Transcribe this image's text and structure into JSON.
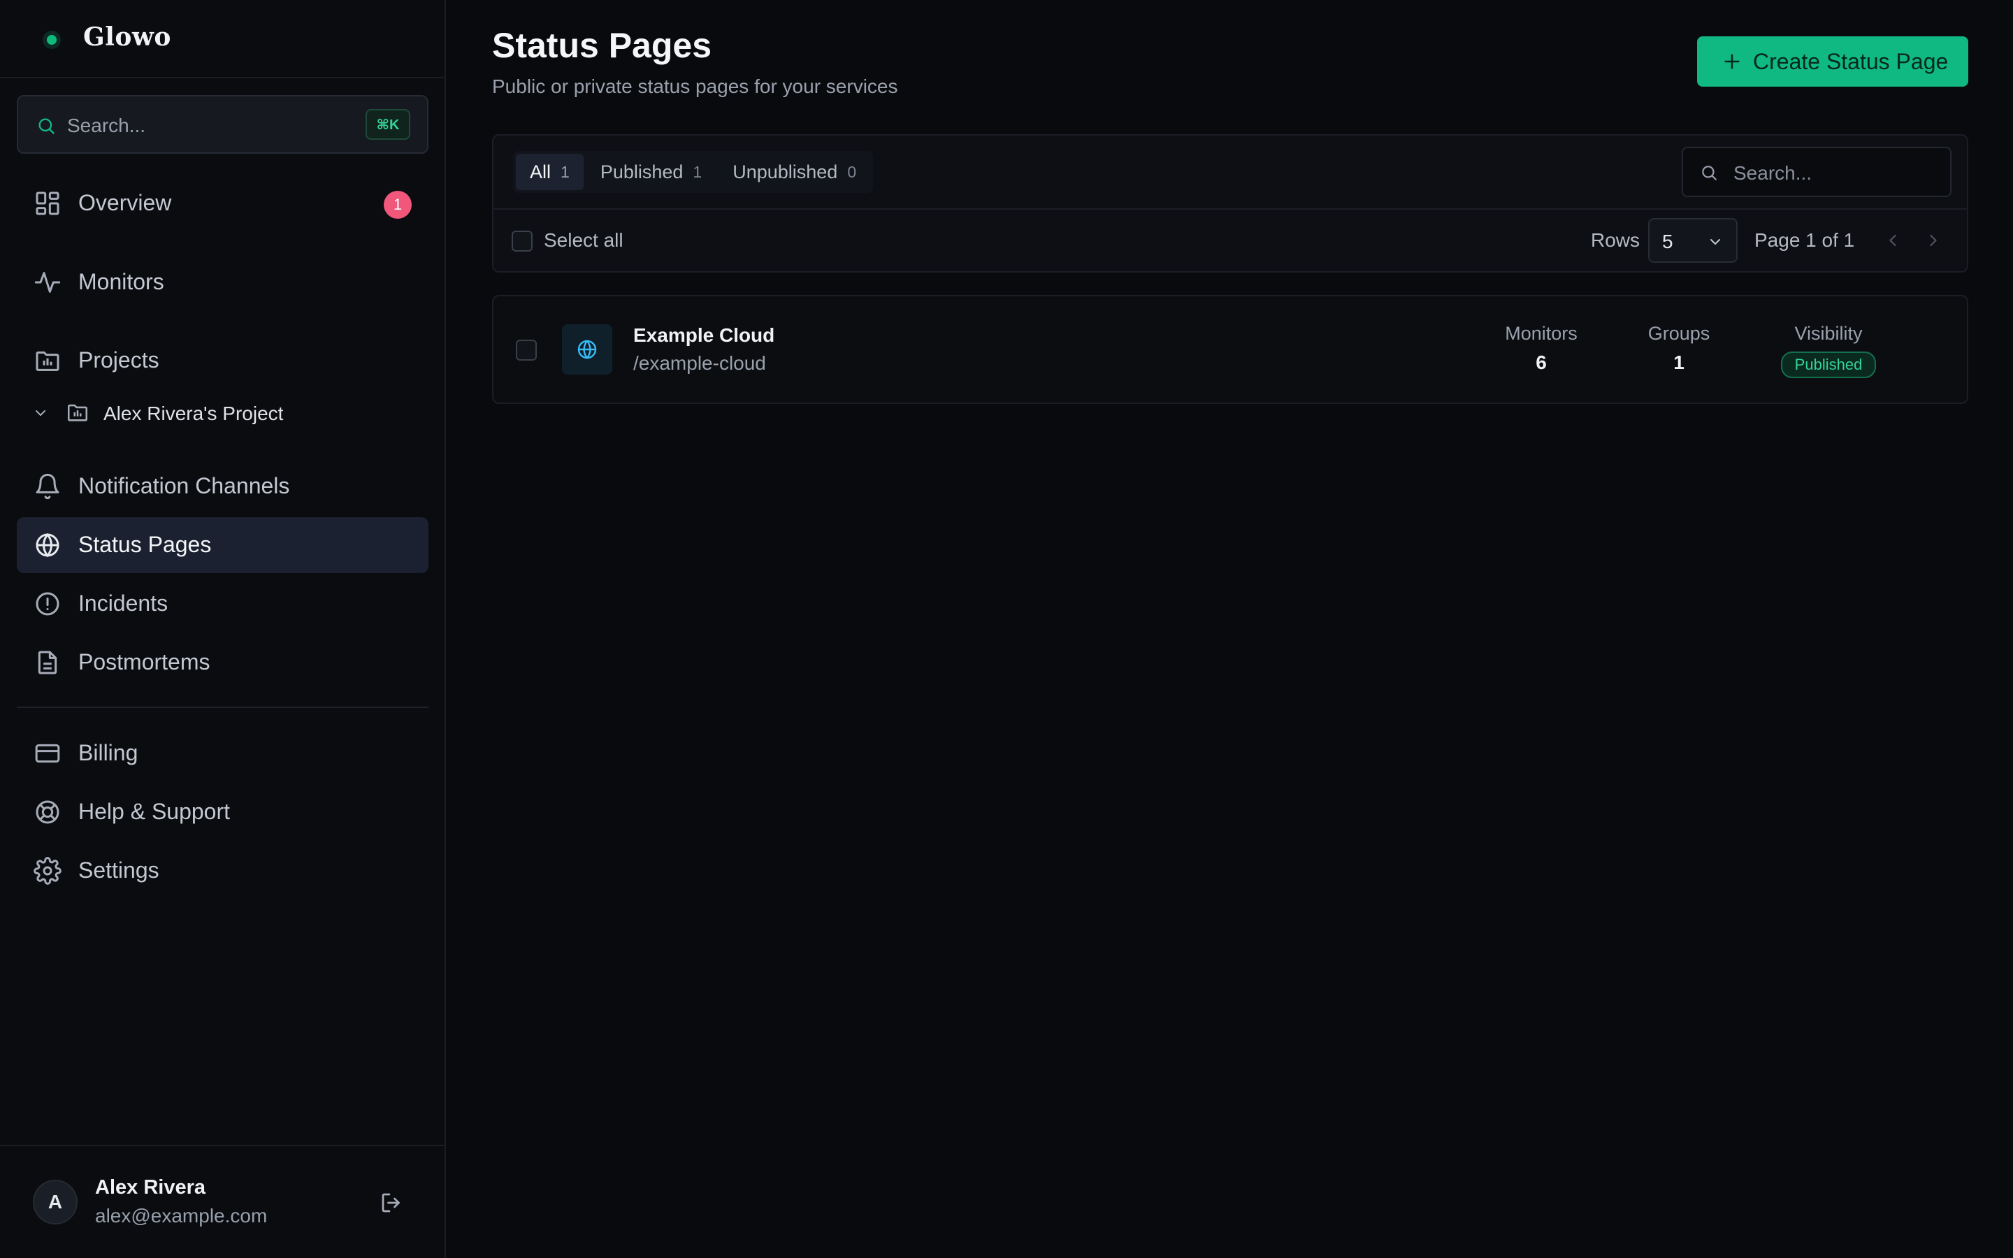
{
  "app": {
    "name": "Glowo"
  },
  "sidebar": {
    "search_placeholder": "Search...",
    "search_shortcut": "⌘K",
    "items": [
      {
        "label": "Overview",
        "icon": "grid-icon",
        "badge": "1"
      },
      {
        "label": "Monitors",
        "icon": "activity-icon"
      },
      {
        "label": "Projects",
        "icon": "folder-icon"
      },
      {
        "label": "Notification Channels",
        "icon": "bell-icon"
      },
      {
        "label": "Status Pages",
        "icon": "globe-icon",
        "active": true
      },
      {
        "label": "Incidents",
        "icon": "alert-circle-icon"
      },
      {
        "label": "Postmortems",
        "icon": "document-icon"
      },
      {
        "label": "Billing",
        "icon": "credit-card-icon"
      },
      {
        "label": "Help & Support",
        "icon": "lifebuoy-icon"
      },
      {
        "label": "Settings",
        "icon": "gear-icon"
      }
    ],
    "project_item": {
      "label": "Alex Rivera's Project"
    },
    "user": {
      "initial": "A",
      "name": "Alex Rivera",
      "email": "alex@example.com"
    }
  },
  "header": {
    "title": "Status Pages",
    "subtitle": "Public or private status pages for your services",
    "create_label": "Create Status Page"
  },
  "toolbar": {
    "tabs": [
      {
        "label": "All",
        "count": "1",
        "active": true
      },
      {
        "label": "Published",
        "count": "1"
      },
      {
        "label": "Unpublished",
        "count": "0"
      }
    ],
    "search_placeholder": "Search...",
    "select_all_label": "Select all",
    "rows_label": "Rows",
    "rows_value": "5",
    "page_info": "Page 1 of 1"
  },
  "rows": [
    {
      "name": "Example Cloud",
      "slug": "/example-cloud",
      "monitors_label": "Monitors",
      "monitors": "6",
      "groups_label": "Groups",
      "groups": "1",
      "visibility_label": "Visibility",
      "visibility": "Published"
    }
  ],
  "colors": {
    "accent": "#10b981",
    "background": "#090a0d",
    "sidebar_active": "#1b2130",
    "badge": "#f0577a",
    "published": "#34d399"
  }
}
